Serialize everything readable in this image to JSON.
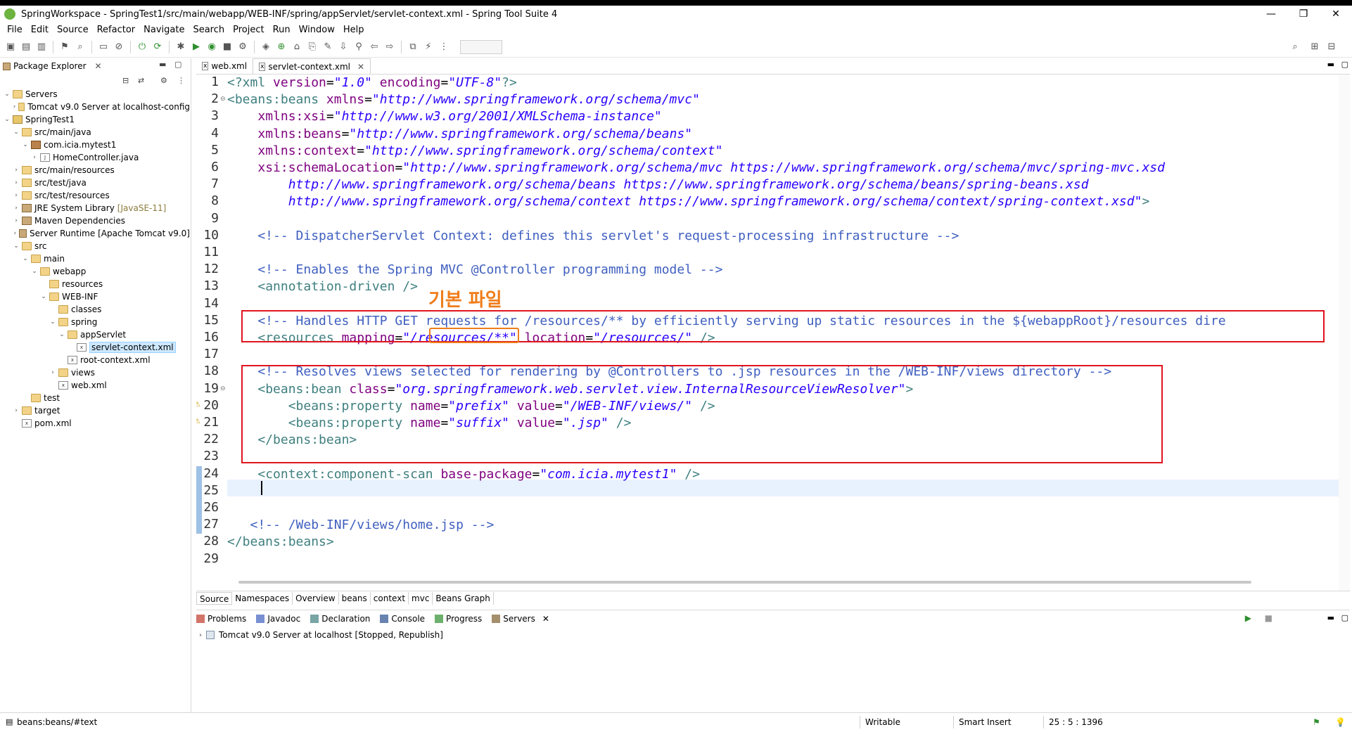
{
  "window": {
    "title": "SpringWorkspace - SpringTest1/src/main/webapp/WEB-INF/spring/appServlet/servlet-context.xml - Spring Tool Suite 4",
    "controls": [
      "—",
      "❐",
      "✕"
    ]
  },
  "menu": [
    "File",
    "Edit",
    "Source",
    "Refactor",
    "Navigate",
    "Search",
    "Project",
    "Run",
    "Window",
    "Help"
  ],
  "explorer": {
    "tab_label": "Package Explorer",
    "tree": [
      {
        "label": "Servers",
        "depth": 0,
        "toggle": "⌄",
        "icon": "folder"
      },
      {
        "label": "Tomcat v9.0 Server at localhost-config",
        "depth": 1,
        "toggle": "›",
        "icon": "folder"
      },
      {
        "label": "SpringTest1",
        "depth": 0,
        "toggle": "⌄",
        "icon": "project"
      },
      {
        "label": "src/main/java",
        "depth": 1,
        "toggle": "⌄",
        "icon": "pkgfolder"
      },
      {
        "label": "com.icia.mytest1",
        "depth": 2,
        "toggle": "⌄",
        "icon": "pkg"
      },
      {
        "label": "HomeController.java",
        "depth": 3,
        "toggle": "›",
        "icon": "file"
      },
      {
        "label": "src/main/resources",
        "depth": 1,
        "toggle": "›",
        "icon": "pkgfolder"
      },
      {
        "label": "src/test/java",
        "depth": 1,
        "toggle": "›",
        "icon": "pkgfolder"
      },
      {
        "label": "src/test/resources",
        "depth": 1,
        "toggle": "›",
        "icon": "pkgfolder"
      },
      {
        "label": "JRE System Library",
        "suffix": "[JavaSE-11]",
        "depth": 1,
        "toggle": "›",
        "icon": "lib"
      },
      {
        "label": "Maven Dependencies",
        "depth": 1,
        "toggle": "›",
        "icon": "lib"
      },
      {
        "label": "Server Runtime [Apache Tomcat v9.0]",
        "depth": 1,
        "toggle": "›",
        "icon": "lib"
      },
      {
        "label": "src",
        "depth": 1,
        "toggle": "⌄",
        "icon": "folder"
      },
      {
        "label": "main",
        "depth": 2,
        "toggle": "⌄",
        "icon": "folder"
      },
      {
        "label": "webapp",
        "depth": 3,
        "toggle": "⌄",
        "icon": "folder"
      },
      {
        "label": "resources",
        "depth": 4,
        "toggle": "",
        "icon": "folder"
      },
      {
        "label": "WEB-INF",
        "depth": 4,
        "toggle": "⌄",
        "icon": "folder"
      },
      {
        "label": "classes",
        "depth": 5,
        "toggle": "",
        "icon": "folder"
      },
      {
        "label": "spring",
        "depth": 5,
        "toggle": "⌄",
        "icon": "folder"
      },
      {
        "label": "appServlet",
        "depth": 6,
        "toggle": "⌄",
        "icon": "folder"
      },
      {
        "label": "servlet-context.xml",
        "depth": 7,
        "toggle": "",
        "icon": "file",
        "selected": true
      },
      {
        "label": "root-context.xml",
        "depth": 6,
        "toggle": "",
        "icon": "file"
      },
      {
        "label": "views",
        "depth": 5,
        "toggle": "›",
        "icon": "folder"
      },
      {
        "label": "web.xml",
        "depth": 5,
        "toggle": "",
        "icon": "file"
      },
      {
        "label": "test",
        "depth": 2,
        "toggle": "",
        "icon": "folder"
      },
      {
        "label": "target",
        "depth": 1,
        "toggle": "›",
        "icon": "folder"
      },
      {
        "label": "pom.xml",
        "depth": 1,
        "toggle": "",
        "icon": "file"
      }
    ]
  },
  "editor": {
    "tabs": [
      {
        "label": "web.xml",
        "active": false
      },
      {
        "label": "servlet-context.xml",
        "active": true
      }
    ],
    "lines": [
      [
        [
          "t-tag",
          "<?xml "
        ],
        [
          "t-attr",
          "version"
        ],
        [
          "t-txt",
          "="
        ],
        [
          "t-val",
          "\"1.0\""
        ],
        [
          "t-txt",
          " "
        ],
        [
          "t-attr",
          "encoding"
        ],
        [
          "t-txt",
          "="
        ],
        [
          "t-val",
          "\"UTF-8\""
        ],
        [
          "t-tag",
          "?>"
        ]
      ],
      [
        [
          "t-tag",
          "<beans:beans "
        ],
        [
          "t-attr",
          "xmlns"
        ],
        [
          "t-txt",
          "="
        ],
        [
          "t-val",
          "\"http://www.springframework.org/schema/mvc\""
        ]
      ],
      [
        [
          "t-txt",
          "    "
        ],
        [
          "t-attr",
          "xmlns:xsi"
        ],
        [
          "t-txt",
          "="
        ],
        [
          "t-val",
          "\"http://www.w3.org/2001/XMLSchema-instance\""
        ]
      ],
      [
        [
          "t-txt",
          "    "
        ],
        [
          "t-attr",
          "xmlns:beans"
        ],
        [
          "t-txt",
          "="
        ],
        [
          "t-val",
          "\"http://www.springframework.org/schema/beans\""
        ]
      ],
      [
        [
          "t-txt",
          "    "
        ],
        [
          "t-attr",
          "xmlns:context"
        ],
        [
          "t-txt",
          "="
        ],
        [
          "t-val",
          "\"http://www.springframework.org/schema/context\""
        ]
      ],
      [
        [
          "t-txt",
          "    "
        ],
        [
          "t-attr",
          "xsi:schemaLocation"
        ],
        [
          "t-txt",
          "="
        ],
        [
          "t-val",
          "\"http://www.springframework.org/schema/mvc https://www.springframework.org/schema/mvc/spring-mvc.xsd"
        ]
      ],
      [
        [
          "t-val",
          "        http://www.springframework.org/schema/beans https://www.springframework.org/schema/beans/spring-beans.xsd"
        ]
      ],
      [
        [
          "t-val",
          "        http://www.springframework.org/schema/context https://www.springframework.org/schema/context/spring-context.xsd\""
        ],
        [
          "t-tag",
          ">"
        ]
      ],
      [],
      [
        [
          "t-com",
          "    <!-- DispatcherServlet Context: defines this servlet's request-processing infrastructure -->"
        ]
      ],
      [],
      [
        [
          "t-com",
          "    <!-- Enables the Spring MVC @Controller programming model -->"
        ]
      ],
      [
        [
          "t-txt",
          "    "
        ],
        [
          "t-tag",
          "<annotation-driven />"
        ]
      ],
      [],
      [
        [
          "t-com",
          "    <!-- Handles HTTP GET requests for /resources/** by efficiently serving up static resources in the ${webappRoot}/resources dire"
        ]
      ],
      [
        [
          "t-txt",
          "    "
        ],
        [
          "t-tag",
          "<resources "
        ],
        [
          "t-attr",
          "mapping"
        ],
        [
          "t-txt",
          "="
        ],
        [
          "t-val",
          "\"/resources/**\""
        ],
        [
          "t-txt",
          " "
        ],
        [
          "t-attr",
          "location"
        ],
        [
          "t-txt",
          "="
        ],
        [
          "t-val",
          "\"/resources/\""
        ],
        [
          "t-txt",
          " "
        ],
        [
          "t-tag",
          "/>"
        ]
      ],
      [],
      [
        [
          "t-com",
          "    <!-- Resolves views selected for rendering by @Controllers to .jsp resources in the /WEB-INF/views directory -->"
        ]
      ],
      [
        [
          "t-txt",
          "    "
        ],
        [
          "t-tag",
          "<beans:bean "
        ],
        [
          "t-attr",
          "class"
        ],
        [
          "t-txt",
          "="
        ],
        [
          "t-val",
          "\"org.springframework.web.servlet.view.InternalResourceViewResolver\""
        ],
        [
          "t-tag",
          ">"
        ]
      ],
      [
        [
          "t-txt",
          "        "
        ],
        [
          "t-tag",
          "<beans:property "
        ],
        [
          "t-attr",
          "name"
        ],
        [
          "t-txt",
          "="
        ],
        [
          "t-val",
          "\"prefix\""
        ],
        [
          "t-txt",
          " "
        ],
        [
          "t-attr",
          "value"
        ],
        [
          "t-txt",
          "="
        ],
        [
          "t-val",
          "\"/WEB-INF/views/\""
        ],
        [
          "t-txt",
          " "
        ],
        [
          "t-tag",
          "/>"
        ]
      ],
      [
        [
          "t-txt",
          "        "
        ],
        [
          "t-tag",
          "<beans:property "
        ],
        [
          "t-attr",
          "name"
        ],
        [
          "t-txt",
          "="
        ],
        [
          "t-val",
          "\"suffix\""
        ],
        [
          "t-txt",
          " "
        ],
        [
          "t-attr",
          "value"
        ],
        [
          "t-txt",
          "="
        ],
        [
          "t-val",
          "\".jsp\""
        ],
        [
          "t-txt",
          " "
        ],
        [
          "t-tag",
          "/>"
        ]
      ],
      [
        [
          "t-txt",
          "    "
        ],
        [
          "t-tag",
          "</beans:bean>"
        ]
      ],
      [],
      [
        [
          "t-txt",
          "    "
        ],
        [
          "t-tag",
          "<context:component-scan "
        ],
        [
          "t-attr",
          "base-package"
        ],
        [
          "t-txt",
          "="
        ],
        [
          "t-val",
          "\"com.icia.mytest1\""
        ],
        [
          "t-txt",
          " "
        ],
        [
          "t-tag",
          "/>"
        ]
      ],
      [],
      [],
      [
        [
          "t-com",
          "   <!-- /Web-INF/views/home.jsp -->"
        ]
      ],
      [
        [
          "t-tag",
          "</beans:beans>"
        ]
      ],
      []
    ],
    "annotation_label": "기본 파일",
    "bottom_tabs": [
      "Source",
      "Namespaces",
      "Overview",
      "beans",
      "context",
      "mvc",
      "Beans Graph"
    ]
  },
  "panel": {
    "tabs": [
      "Problems",
      "Javadoc",
      "Declaration",
      "Console",
      "Progress",
      "Servers"
    ],
    "active_tab": "Servers",
    "server_row": "Tomcat v9.0 Server at localhost  [Stopped, Republish]"
  },
  "status": {
    "path": "beans:beans/#text",
    "mode": "Writable",
    "insert": "Smart Insert",
    "position": "25 : 5 : 1396"
  }
}
